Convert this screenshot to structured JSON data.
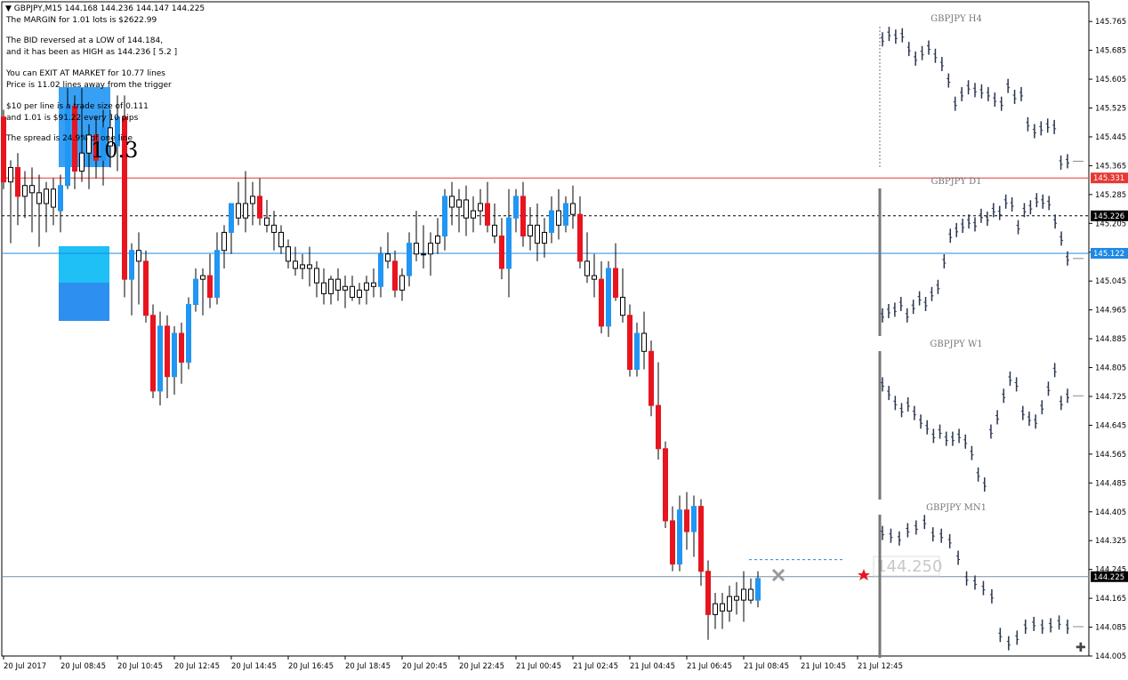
{
  "header": {
    "arrow": "▼",
    "text": "GBPJPY,M15  144.168 144.236 144.147 144.225"
  },
  "info_lines": [
    "The MARGIN for 1.01 lots is $2622.99",
    "",
    "The BID reversed at a LOW of 144.184,",
    "and it has been as HIGH as 144.236 [ 5.2 ]",
    "",
    "You can EXIT AT MARKET for 10.77 lines",
    "Price is  11.02 lines away from the trigger",
    "",
    "$10 per line is a trade size of 0.111",
    "and 1.01 is $91.22 every 10 pips",
    "",
    "The spread is 24.9% of one line"
  ],
  "big_number": "10.3",
  "floating_price": "144.250",
  "colors": {
    "bull": "#2196f3",
    "bear": "#e8141e",
    "neutral": "#000000",
    "red_line": "#e53935",
    "blue_line": "#1e88e5",
    "gray_line": "#7a8fa6",
    "mini": "#2a3650"
  },
  "chart_data": {
    "type": "candlestick",
    "symbol": "GBPJPY",
    "timeframe": "M15",
    "ylim": [
      144.005,
      145.795
    ],
    "y_ticks": [
      "145.765",
      "145.685",
      "145.605",
      "145.525",
      "145.445",
      "145.365",
      "145.285",
      "145.205",
      "145.125",
      "145.045",
      "144.965",
      "144.885",
      "144.805",
      "144.725",
      "144.645",
      "144.565",
      "144.485",
      "144.405",
      "144.325",
      "144.245",
      "144.165",
      "144.085",
      "144.005"
    ],
    "x_ticks": [
      "20 Jul 2017",
      "20 Jul 08:45",
      "20 Jul 10:45",
      "20 Jul 12:45",
      "20 Jul 14:45",
      "20 Jul 16:45",
      "20 Jul 18:45",
      "20 Jul 20:45",
      "20 Jul 22:45",
      "21 Jul 00:45",
      "21 Jul 02:45",
      "21 Jul 04:45",
      "21 Jul 06:45",
      "21 Jul 08:45",
      "21 Jul 10:45",
      "21 Jul 12:45"
    ],
    "hlines": [
      {
        "price": 145.331,
        "label": "145.331",
        "style": "red"
      },
      {
        "price": 145.226,
        "label": "145.226",
        "style": "dashed"
      },
      {
        "price": 145.122,
        "label": "145.122",
        "style": "blue"
      },
      {
        "price": 144.225,
        "label": "144.225",
        "style": "gray"
      }
    ],
    "candles": [
      [
        145.5,
        145.52,
        145.3,
        145.32
      ],
      [
        145.32,
        145.38,
        145.15,
        145.36
      ],
      [
        145.36,
        145.4,
        145.2,
        145.28
      ],
      [
        145.28,
        145.35,
        145.22,
        145.31
      ],
      [
        145.31,
        145.36,
        145.18,
        145.29
      ],
      [
        145.29,
        145.34,
        145.14,
        145.26
      ],
      [
        145.26,
        145.32,
        145.18,
        145.3
      ],
      [
        145.3,
        145.33,
        145.2,
        145.25
      ],
      [
        145.24,
        145.34,
        145.18,
        145.31
      ],
      [
        145.31,
        145.58,
        145.3,
        145.53
      ],
      [
        145.53,
        145.56,
        145.3,
        145.35
      ],
      [
        145.35,
        145.58,
        145.32,
        145.4
      ],
      [
        145.4,
        145.48,
        145.3,
        145.45
      ],
      [
        145.45,
        145.5,
        145.33,
        145.38
      ],
      [
        145.38,
        145.52,
        145.31,
        145.47
      ],
      [
        145.47,
        145.52,
        145.36,
        145.42
      ],
      [
        145.42,
        145.56,
        145.35,
        145.5
      ],
      [
        145.5,
        145.56,
        145.0,
        145.05
      ],
      [
        145.05,
        145.15,
        144.95,
        145.13
      ],
      [
        145.13,
        145.18,
        144.98,
        145.1
      ],
      [
        145.1,
        145.13,
        144.93,
        144.95
      ],
      [
        144.95,
        144.98,
        144.72,
        144.74
      ],
      [
        144.74,
        144.96,
        144.7,
        144.92
      ],
      [
        144.92,
        144.95,
        144.72,
        144.78
      ],
      [
        144.78,
        144.92,
        144.73,
        144.9
      ],
      [
        144.9,
        144.93,
        144.76,
        144.82
      ],
      [
        144.82,
        145.0,
        144.8,
        144.98
      ],
      [
        144.98,
        145.08,
        144.96,
        145.05
      ],
      [
        145.05,
        145.08,
        144.95,
        145.06
      ],
      [
        145.06,
        145.12,
        144.97,
        145.0
      ],
      [
        145.0,
        145.18,
        144.98,
        145.13
      ],
      [
        145.13,
        145.2,
        145.08,
        145.18
      ],
      [
        145.18,
        145.26,
        145.12,
        145.26
      ],
      [
        145.26,
        145.32,
        145.2,
        145.22
      ],
      [
        145.22,
        145.35,
        145.18,
        145.26
      ],
      [
        145.26,
        145.32,
        145.2,
        145.28
      ],
      [
        145.28,
        145.33,
        145.2,
        145.22
      ],
      [
        145.22,
        145.27,
        145.18,
        145.2
      ],
      [
        145.2,
        145.24,
        145.13,
        145.18
      ],
      [
        145.18,
        145.2,
        145.12,
        145.14
      ],
      [
        145.14,
        145.16,
        145.08,
        145.1
      ],
      [
        145.1,
        145.14,
        145.06,
        145.08
      ],
      [
        145.08,
        145.12,
        145.05,
        145.09
      ],
      [
        145.09,
        145.14,
        145.03,
        145.08
      ],
      [
        145.08,
        145.1,
        145.0,
        145.04
      ],
      [
        145.04,
        145.08,
        144.98,
        145.01
      ],
      [
        145.01,
        145.06,
        144.98,
        145.05
      ],
      [
        145.05,
        145.08,
        144.99,
        145.02
      ],
      [
        145.02,
        145.06,
        144.97,
        145.03
      ],
      [
        145.03,
        145.06,
        144.99,
        145.0
      ],
      [
        145.0,
        145.04,
        144.98,
        145.02
      ],
      [
        145.02,
        145.06,
        144.98,
        145.04
      ],
      [
        145.04,
        145.08,
        145.0,
        145.03
      ],
      [
        145.03,
        145.14,
        145.0,
        145.12
      ],
      [
        145.12,
        145.18,
        145.08,
        145.1
      ],
      [
        145.1,
        145.13,
        145.0,
        145.02
      ],
      [
        145.02,
        145.08,
        144.99,
        145.06
      ],
      [
        145.06,
        145.18,
        145.03,
        145.15
      ],
      [
        145.15,
        145.24,
        145.1,
        145.12
      ],
      [
        145.12,
        145.2,
        145.08,
        145.12
      ],
      [
        145.12,
        145.18,
        145.06,
        145.15
      ],
      [
        145.15,
        145.22,
        145.12,
        145.17
      ],
      [
        145.17,
        145.3,
        145.13,
        145.28
      ],
      [
        145.28,
        145.32,
        145.2,
        145.25
      ],
      [
        145.25,
        145.3,
        145.18,
        145.27
      ],
      [
        145.27,
        145.31,
        145.17,
        145.22
      ],
      [
        145.22,
        145.28,
        145.18,
        145.24
      ],
      [
        145.24,
        145.3,
        145.2,
        145.26
      ],
      [
        145.26,
        145.32,
        145.18,
        145.2
      ],
      [
        145.2,
        145.26,
        145.15,
        145.17
      ],
      [
        145.17,
        145.22,
        145.05,
        145.08
      ],
      [
        145.08,
        145.3,
        145.0,
        145.22
      ],
      [
        145.22,
        145.3,
        145.18,
        145.28
      ],
      [
        145.28,
        145.32,
        145.14,
        145.17
      ],
      [
        145.17,
        145.25,
        145.13,
        145.2
      ],
      [
        145.2,
        145.26,
        145.1,
        145.15
      ],
      [
        145.15,
        145.22,
        145.11,
        145.18
      ],
      [
        145.18,
        145.28,
        145.15,
        145.24
      ],
      [
        145.24,
        145.3,
        145.16,
        145.2
      ],
      [
        145.2,
        145.28,
        145.18,
        145.26
      ],
      [
        145.26,
        145.31,
        145.19,
        145.23
      ],
      [
        145.23,
        145.28,
        145.08,
        145.1
      ],
      [
        145.1,
        145.18,
        145.04,
        145.06
      ],
      [
        145.06,
        145.12,
        145.0,
        145.05
      ],
      [
        145.05,
        145.1,
        144.9,
        144.92
      ],
      [
        144.92,
        145.1,
        144.89,
        145.08
      ],
      [
        145.08,
        145.15,
        144.99,
        145.0
      ],
      [
        145.0,
        145.08,
        144.93,
        144.95
      ],
      [
        144.95,
        144.98,
        144.78,
        144.8
      ],
      [
        144.8,
        144.93,
        144.78,
        144.9
      ],
      [
        144.9,
        144.96,
        144.8,
        144.85
      ],
      [
        144.85,
        144.88,
        144.67,
        144.7
      ],
      [
        144.7,
        144.82,
        144.55,
        144.58
      ],
      [
        144.58,
        144.6,
        144.36,
        144.38
      ],
      [
        144.38,
        144.42,
        144.24,
        144.26
      ],
      [
        144.26,
        144.45,
        144.24,
        144.41
      ],
      [
        144.41,
        144.46,
        144.3,
        144.35
      ],
      [
        144.35,
        144.45,
        144.28,
        144.42
      ],
      [
        144.42,
        144.44,
        144.2,
        144.24
      ],
      [
        144.24,
        144.27,
        144.05,
        144.12
      ],
      [
        144.12,
        144.18,
        144.08,
        144.15
      ],
      [
        144.15,
        144.18,
        144.08,
        144.13
      ],
      [
        144.13,
        144.2,
        144.1,
        144.17
      ],
      [
        144.17,
        144.21,
        144.12,
        144.16
      ],
      [
        144.16,
        144.24,
        144.1,
        144.19
      ],
      [
        144.19,
        144.22,
        144.15,
        144.16
      ],
      [
        144.16,
        144.24,
        144.14,
        144.22
      ]
    ],
    "mini_charts": [
      {
        "label": "GBPJPY H4",
        "top": 13,
        "bottom": 190,
        "bar_top": 30,
        "bar_bottom": 190,
        "series": [
          0.08,
          0.04,
          0.06,
          0.05,
          0.15,
          0.22,
          0.18,
          0.14,
          0.2,
          0.26,
          0.38,
          0.55,
          0.48,
          0.43,
          0.45,
          0.46,
          0.48,
          0.52,
          0.55,
          0.42,
          0.5,
          0.48,
          0.7,
          0.75,
          0.73,
          0.71,
          0.72,
          0.98,
          0.97
        ]
      },
      {
        "label": "GBPJPY D1",
        "top": 196,
        "bottom": 378,
        "bar_top": 212,
        "bar_bottom": 378,
        "series": [
          0.88,
          0.85,
          0.84,
          0.8,
          0.88,
          0.82,
          0.76,
          0.8,
          0.73,
          0.68,
          0.5,
          0.32,
          0.28,
          0.25,
          0.22,
          0.24,
          0.18,
          0.2,
          0.14,
          0.16,
          0.08,
          0.1,
          0.26,
          0.14,
          0.12,
          0.07,
          0.08,
          0.09,
          0.22,
          0.34,
          0.48
        ]
      },
      {
        "label": "GBPJPY W1",
        "top": 379,
        "bottom": 562,
        "bar_top": 395,
        "bar_bottom": 562,
        "series": [
          0.22,
          0.28,
          0.35,
          0.4,
          0.36,
          0.42,
          0.48,
          0.52,
          0.58,
          0.55,
          0.6,
          0.6,
          0.58,
          0.62,
          0.7,
          0.85,
          0.92,
          0.55,
          0.45,
          0.3,
          0.18,
          0.22,
          0.42,
          0.46,
          0.48,
          0.38,
          0.25,
          0.12,
          0.35,
          0.3
        ]
      },
      {
        "label": "GBPJPY MN1",
        "top": 563,
        "bottom": 740,
        "bar_top": 579,
        "bar_bottom": 740,
        "series": [
          0.12,
          0.14,
          0.16,
          0.1,
          0.08,
          0.04,
          0.13,
          0.14,
          0.18,
          0.3,
          0.45,
          0.48,
          0.52,
          0.58,
          0.86,
          0.92,
          0.88,
          0.8,
          0.78,
          0.8,
          0.79,
          0.77,
          0.8
        ]
      }
    ]
  }
}
